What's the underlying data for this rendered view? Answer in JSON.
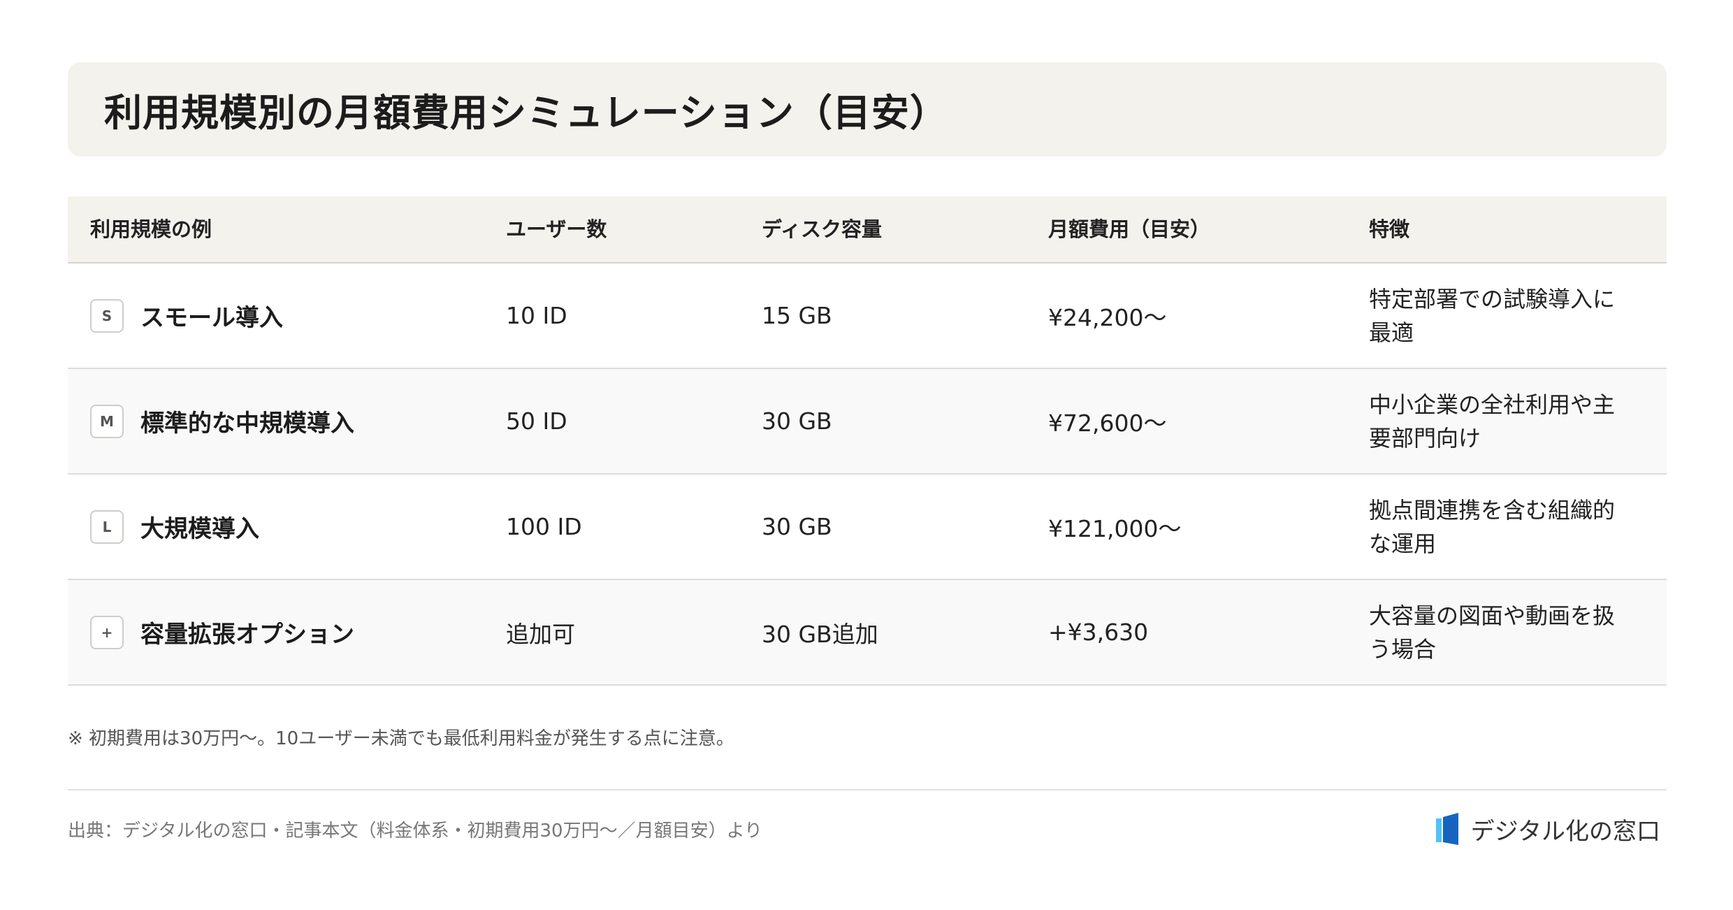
{
  "title": "利用規模別の月額費用シミュレーション（目安）",
  "table": {
    "headers": {
      "scale": "利用規模の例",
      "users": "ユーザー数",
      "disk": "ディスク容量",
      "monthly": "月額費用（目安）",
      "feature": "特徴"
    },
    "rows": [
      {
        "badge": "S",
        "name": "スモール導入",
        "users": "10 ID",
        "disk": "15 GB",
        "monthly": "¥24,200〜",
        "feature": "特定部署での試験導入に最適"
      },
      {
        "badge": "M",
        "name": "標準的な中規模導入",
        "users": "50 ID",
        "disk": "30 GB",
        "monthly": "¥72,600〜",
        "feature": "中小企業の全社利用や主要部門向け"
      },
      {
        "badge": "L",
        "name": "大規模導入",
        "users": "100 ID",
        "disk": "30 GB",
        "monthly": "¥121,000〜",
        "feature": "拠点間連携を含む組織的な運用"
      },
      {
        "badge": "+",
        "name": "容量拡張オプション",
        "users": "追加可",
        "disk": "30 GB追加",
        "monthly": "+¥3,630",
        "feature": "大容量の図面や動画を扱う場合"
      }
    ]
  },
  "note": "※ 初期費用は30万円〜。10ユーザー未満でも最低利用料金が発生する点に注意。",
  "source": "出典：デジタル化の窓口・記事本文（料金体系・初期費用30万円〜／月額目安）より",
  "logo": {
    "text": "デジタル化の窓口",
    "icon": "window-logo-icon",
    "colors": {
      "dark": "#1565c0",
      "light": "#4fc3f7"
    }
  },
  "colors": {
    "header_bg": "#f4f2ec",
    "alt_row_bg": "#f9f9f9"
  }
}
